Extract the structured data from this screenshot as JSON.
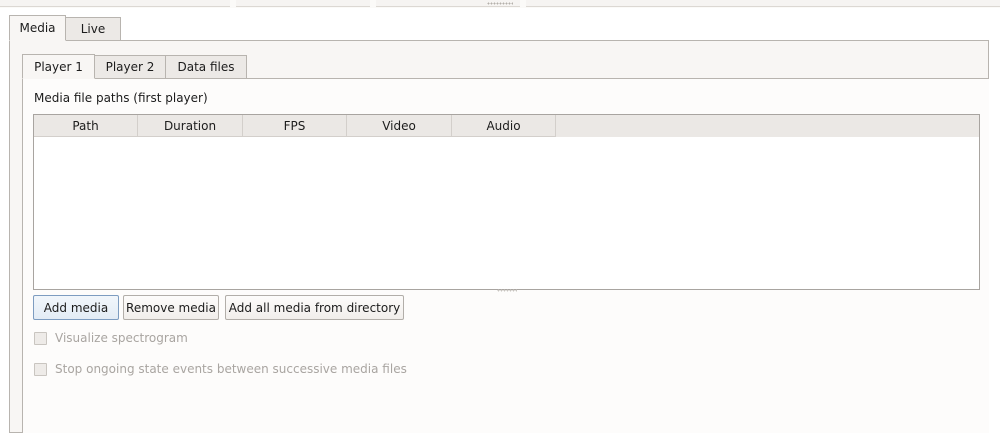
{
  "outer_tabs": [
    {
      "label": "Media",
      "active": true
    },
    {
      "label": "Live",
      "active": false
    }
  ],
  "inner_tabs": [
    {
      "label": "Player 1",
      "active": true
    },
    {
      "label": "Player 2",
      "active": false
    },
    {
      "label": "Data files",
      "active": false
    }
  ],
  "media_section": {
    "label": "Media file paths (first player)",
    "columns": [
      "Path",
      "Duration",
      "FPS",
      "Video",
      "Audio"
    ],
    "rows": []
  },
  "buttons": {
    "add_media": "Add media",
    "remove_media": "Remove media",
    "add_all_from_directory": "Add all media from directory"
  },
  "options": {
    "visualize_spectrogram": {
      "label": "Visualize spectrogram",
      "checked": false,
      "enabled": false
    },
    "stop_state_events": {
      "label": "Stop ongoing state events between successive media files",
      "checked": false,
      "enabled": false
    }
  }
}
